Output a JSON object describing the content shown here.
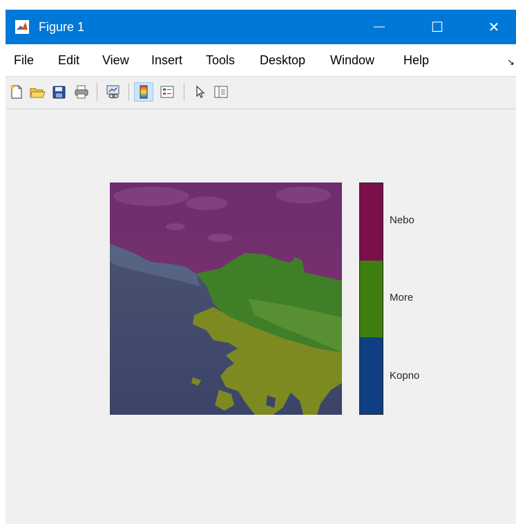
{
  "window": {
    "title": "Figure 1",
    "minimize_glyph": "—",
    "maximize_glyph": "☐",
    "close_glyph": "✕"
  },
  "menu": {
    "items": [
      "File",
      "Edit",
      "View",
      "Insert",
      "Tools",
      "Desktop",
      "Window",
      "Help"
    ],
    "overflow_glyph": "↘"
  },
  "toolbar": {
    "buttons": [
      "new-figure-icon",
      "open-file-icon",
      "save-icon",
      "print-icon",
      "link-plot-icon",
      "colorbar-icon",
      "legend-icon",
      "pointer-icon",
      "property-inspector-icon"
    ],
    "active": "colorbar-icon"
  },
  "colorbar": {
    "labels": [
      "Nebo",
      "More",
      "Kopno"
    ],
    "colors": [
      "#7b0f4a",
      "#3f7f10",
      "#0f3f82"
    ]
  },
  "image_colors": {
    "sky": "#7a2f6f",
    "sea": "#3d7f25",
    "sand": "#7f8a22",
    "land": "#3f4870"
  }
}
